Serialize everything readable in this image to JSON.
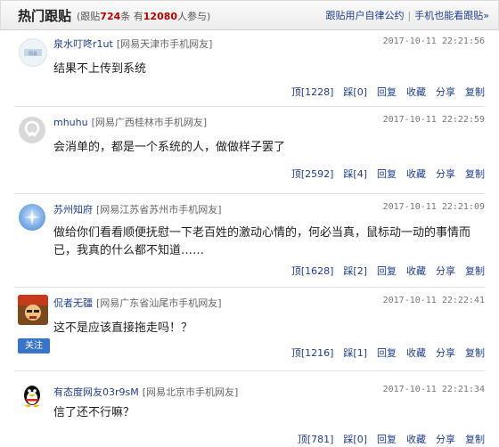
{
  "header": {
    "title": "热门跟贴",
    "stats_prefix": "(跟贴",
    "follow_count": "724",
    "stats_mid": "条 有",
    "participants": "12080",
    "stats_suffix": "人参与)",
    "link_rules": "跟贴用户自律公约",
    "link_mobile": "手机也能看跟贴»"
  },
  "posts": [
    {
      "user": "泉水叮咚r1ut",
      "location": "[网易天津市手机网友]",
      "time": "2017-10-11  22:21:56",
      "content": "结果不上传到系统",
      "upvote": "顶[1228]",
      "downvote": "踩[0]",
      "reply": "回复",
      "save": "收藏",
      "share": "分享",
      "copy": "复制"
    },
    {
      "user": "mhuhu",
      "location": "[网易广西桂林市手机网友]",
      "time": "2017-10-11  22:22:59",
      "content": "会消单的，都是一个系统的人，做做样子罢了",
      "upvote": "顶[2592]",
      "downvote": "踩[4]",
      "reply": "回复",
      "save": "收藏",
      "share": "分享",
      "copy": "复制"
    },
    {
      "user": "苏州知府",
      "location": "[网易江苏省苏州市手机网友]",
      "time": "2017-10-11  22:21:09",
      "content": "做给你们看看顺便抚慰一下老百姓的激动心情的，何必当真，鼠标动一动的事情而已，我真的什么都不知道……",
      "upvote": "顶[1628]",
      "downvote": "踩[2]",
      "reply": "回复",
      "save": "收藏",
      "share": "分享",
      "copy": "复制"
    },
    {
      "user": "侃者无疆",
      "location": "[网易广东省汕尾市手机网友]",
      "time": "2017-10-11  22:22:41",
      "content": "这不是应该直接拖走吗！？",
      "follow": "关注",
      "upvote": "顶[1216]",
      "downvote": "踩[1]",
      "reply": "回复",
      "save": "收藏",
      "share": "分享",
      "copy": "复制"
    },
    {
      "user": "有态度网友03r9sM",
      "location": "[网易北京市手机网友]",
      "time": "2017-10-11  22:21:34",
      "content": "信了还不行嘛？",
      "upvote": "顶[781]",
      "downvote": "踩[0]",
      "reply": "回复",
      "save": "收藏",
      "share": "分享",
      "copy": "复制"
    }
  ]
}
